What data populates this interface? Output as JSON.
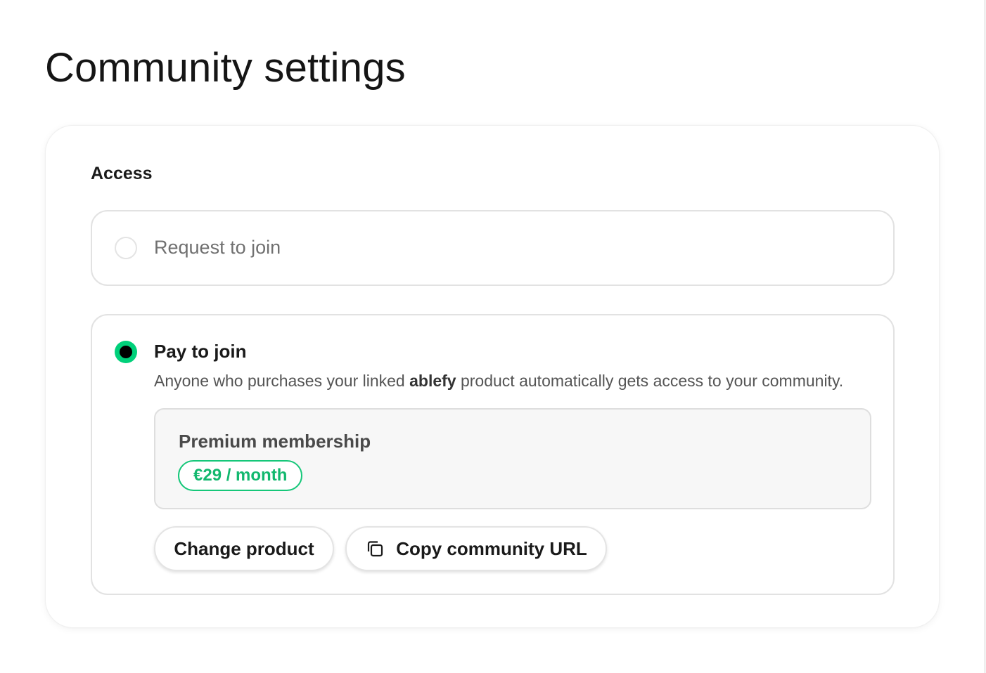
{
  "page": {
    "title": "Community settings"
  },
  "access": {
    "heading": "Access",
    "options": {
      "request": {
        "label": "Request to join",
        "selected": false
      },
      "pay": {
        "label": "Pay to join",
        "selected": true,
        "description_prefix": "Anyone who purchases your linked ",
        "description_brand": "ablefy",
        "description_suffix": " product automatically gets access to your community.",
        "product": {
          "name": "Premium membership",
          "price": "€29 / month"
        },
        "buttons": {
          "change_product": "Change product",
          "copy_url": "Copy community URL"
        }
      }
    }
  },
  "colors": {
    "accent": "#00d07a",
    "price_text": "#12b86e"
  },
  "icons": {
    "copy": "copy-icon"
  }
}
